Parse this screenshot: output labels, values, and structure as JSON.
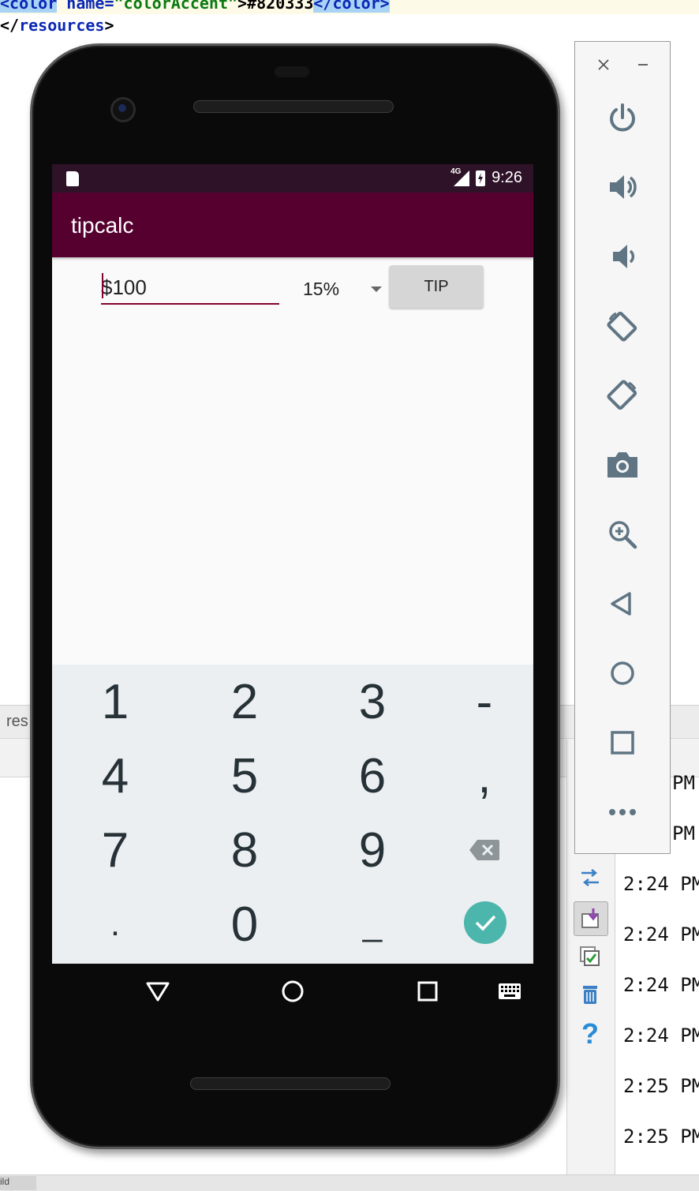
{
  "ide": {
    "code_line1": {
      "indent": "    ",
      "tag_open": "<color",
      "attr": " name=",
      "attr_value": "\"colorAccent\"",
      "value": ">#820333",
      "tag_close": "</color>"
    },
    "code_line2": {
      "open": "</",
      "tag": "resources",
      "close": ">"
    },
    "panel_label": "res",
    "bottom_tab": "ild",
    "log_times": [
      "PM",
      "PM",
      "2:24 PM",
      "2:24 PM",
      "2:24 PM",
      "2:24 PM",
      "2:25 PM",
      "2:25 PM"
    ]
  },
  "device": {
    "status_bar": {
      "network": "4G",
      "time": "9:26"
    },
    "app": {
      "title": "tipcalc",
      "amount_value": "$100",
      "tip_percent": "15%",
      "tip_button": "TIP",
      "colors": {
        "primary": "#560030",
        "primary_dark": "#2e1228",
        "accent": "#820333"
      }
    },
    "keyboard": {
      "rows": [
        [
          "1",
          "2",
          "3",
          "-"
        ],
        [
          "4",
          "5",
          "6",
          ","
        ],
        [
          "7",
          "8",
          "9",
          "backspace-icon"
        ],
        [
          ".",
          "0",
          "_",
          "done-icon"
        ]
      ],
      "accent_color": "#4db6ac"
    },
    "nav": [
      "back-icon",
      "home-icon",
      "recents-icon",
      "keyboard-icon"
    ]
  },
  "emulator_toolbar": {
    "window_controls": [
      "close-icon",
      "minimize-icon"
    ],
    "buttons": [
      "power-icon",
      "volume-up-icon",
      "volume-down-icon",
      "rotate-left-icon",
      "rotate-right-icon",
      "screenshot-icon",
      "zoom-icon",
      "back-icon",
      "home-icon",
      "overview-icon",
      "more-icon"
    ]
  }
}
